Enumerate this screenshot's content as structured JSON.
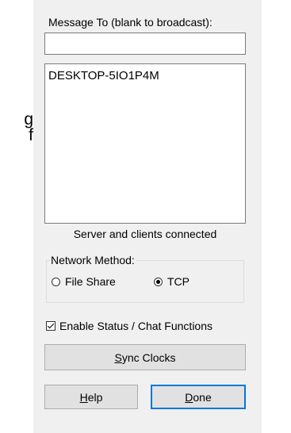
{
  "background": {
    "partial_line_1": "g",
    "partial_line_2": "f"
  },
  "dialog": {
    "message_to_label": "Message To (blank to broadcast):",
    "message_to_value": "",
    "clients": [
      "DESKTOP-5IO1P4M"
    ],
    "status_text": "Server and clients connected",
    "network_method": {
      "title": "Network Method:",
      "options": [
        {
          "label": "File Share",
          "selected": false
        },
        {
          "label": "TCP",
          "selected": true
        }
      ]
    },
    "enable_status": {
      "label": "Enable Status /  Chat Functions",
      "checked": true
    },
    "buttons": {
      "sync": {
        "mnemonic": "S",
        "rest": "ync Clocks"
      },
      "help": {
        "mnemonic": "H",
        "rest": "elp"
      },
      "done": {
        "mnemonic": "D",
        "rest": "one"
      }
    }
  },
  "colors": {
    "dialog_bg": "#f0f0f0",
    "default_button_border": "#0078d7"
  }
}
